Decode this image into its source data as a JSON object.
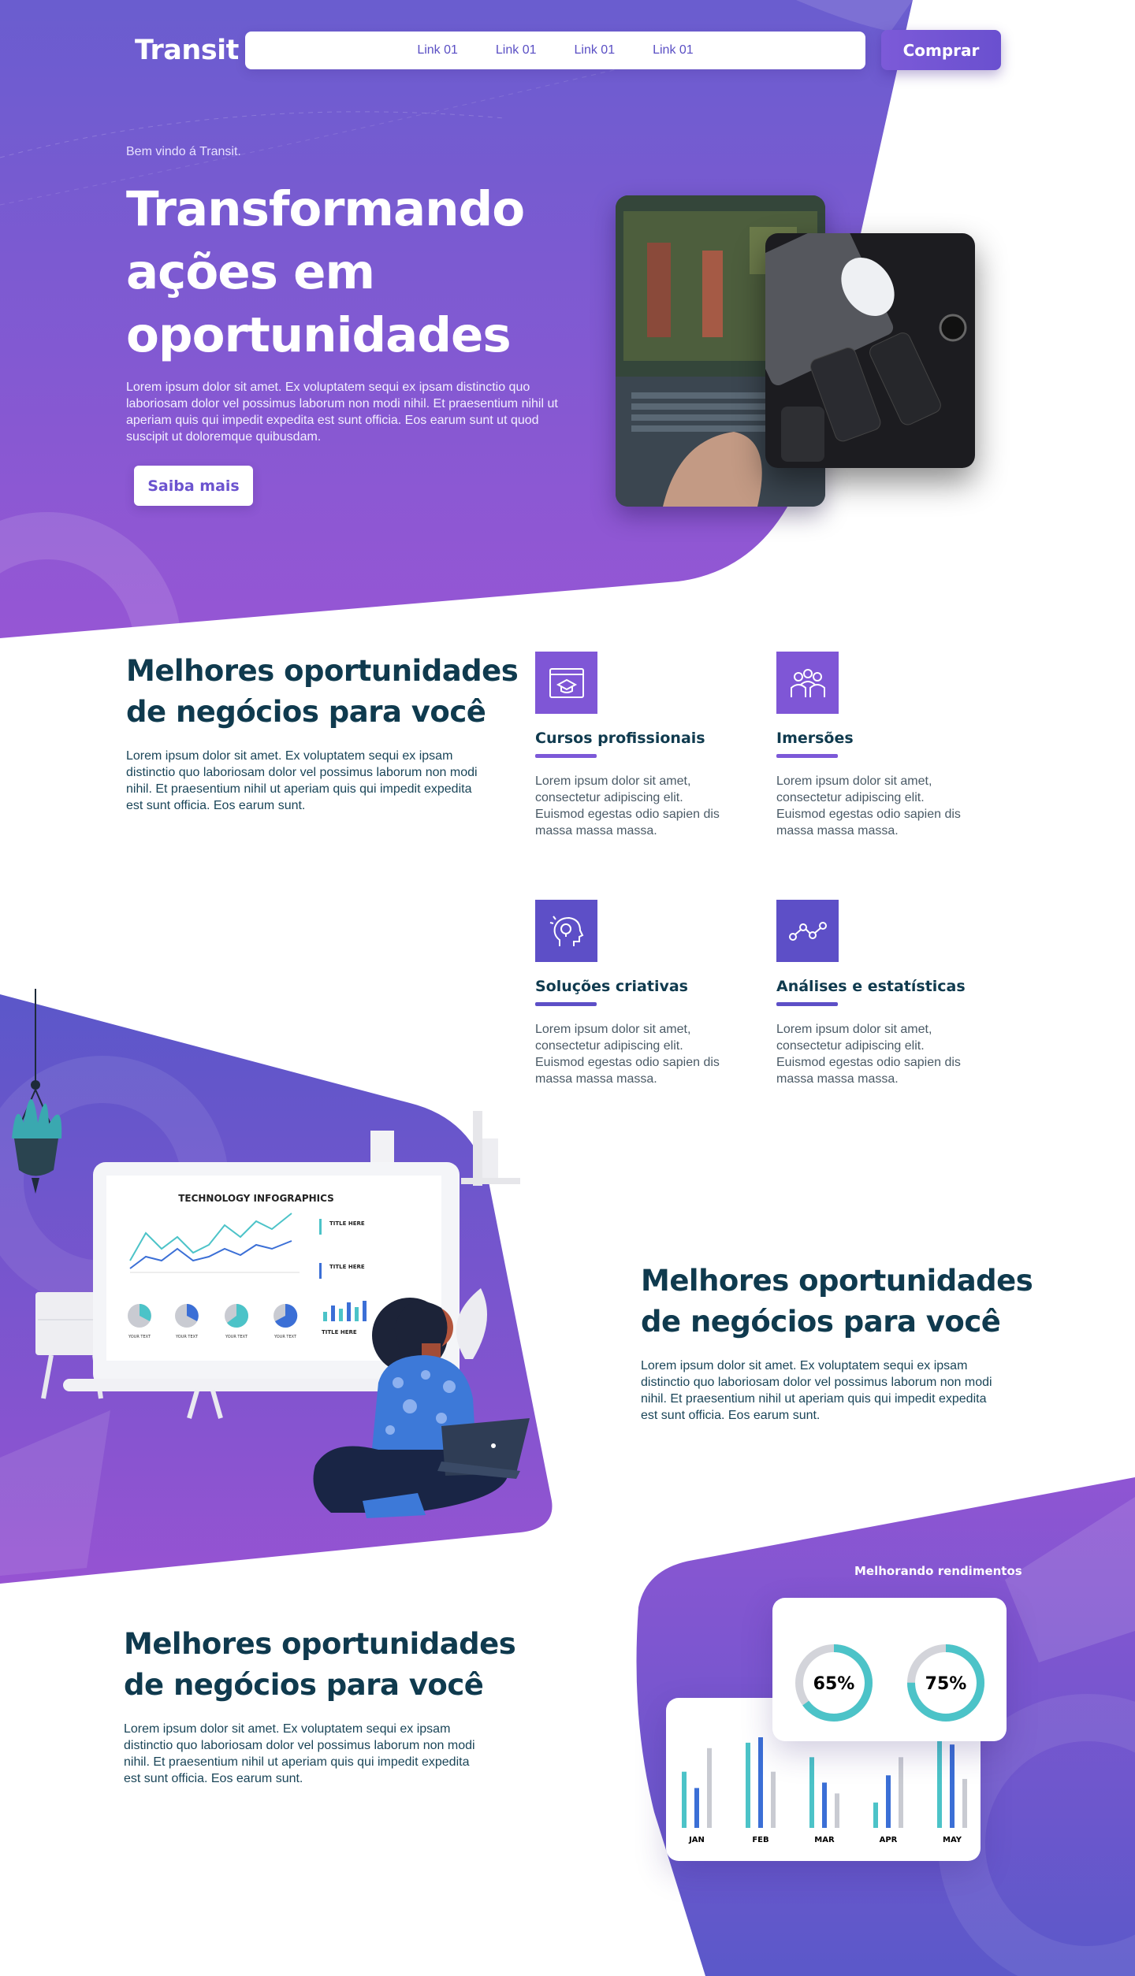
{
  "header": {
    "logo": "Transit",
    "nav_links": [
      "Link 01",
      "Link 01",
      "Link 01",
      "Link 01"
    ],
    "buy_label": "Comprar"
  },
  "hero": {
    "welcome": "Bem vindo á Transit.",
    "title": "Transformando ações em oportunidades",
    "description": "Lorem ipsum dolor sit amet. Ex voluptatem sequi ex ipsam distinctio quo laboriosam dolor vel possimus laborum non modi nihil. Et praesentium nihil ut aperiam quis qui impedit expedita est sunt officia. Eos earum sunt ut quod suscipit ut doloremque quibusdam.",
    "cta_label": "Saiba mais"
  },
  "opportunities": {
    "title": "Melhores oportunidades de negócios para você",
    "description": "Lorem ipsum dolor sit amet. Ex voluptatem sequi ex ipsam distinctio quo laboriosam dolor vel possimus laborum non modi nihil. Et praesentium nihil ut aperiam quis qui impedit expedita est sunt officia. Eos earum sunt.",
    "features": [
      {
        "title": "Cursos profissionais",
        "icon": "graduation-cap-browser-icon",
        "description": "Lorem ipsum dolor sit amet, consectetur adipiscing elit. Euismod egestas odio sapien dis massa massa massa."
      },
      {
        "title": "Imersões",
        "icon": "group-people-icon",
        "description": "Lorem ipsum dolor sit amet, consectetur adipiscing elit. Euismod egestas odio sapien dis massa massa massa."
      },
      {
        "title": "Soluções criativas",
        "icon": "head-lightbulb-icon",
        "description": "Lorem ipsum dolor sit amet, consectetur adipiscing elit. Euismod egestas odio sapien dis massa massa massa."
      },
      {
        "title": "Análises e estatísticas",
        "icon": "line-chart-nodes-icon",
        "description": "Lorem ipsum dolor sit amet, consectetur adipiscing elit. Euismod egestas odio sapien dis massa massa massa."
      }
    ]
  },
  "illustration_section": {
    "title": "Melhores oportunidades de negócios para você",
    "description": "Lorem ipsum dolor sit amet. Ex voluptatem sequi ex ipsam distinctio quo laboriosam dolor vel possimus laborum non modi nihil. Et praesentium nihil ut aperiam quis qui impedit expedita est sunt officia. Eos earum sunt.",
    "screen": {
      "title": "TECHNOLOGY INFOGRAPHICS",
      "side_title_1": "TITLE HERE",
      "side_title_2": "TITLE HERE",
      "bottom_title": "TITLE HERE",
      "pie_labels": [
        "YOUR TEXT",
        "YOUR TEXT",
        "YOUR TEXT",
        "YOUR TEXT"
      ]
    }
  },
  "stats_section": {
    "title": "Melhores oportunidades de negócios para você",
    "description": "Lorem ipsum dolor sit amet. Ex voluptatem sequi ex ipsam distinctio quo laboriosam dolor vel possimus laborum non modi nihil. Et praesentium nihil ut aperiam quis qui impedit expedita est sunt officia. Eos earum sunt.",
    "label": "Melhorando rendimentos",
    "donuts": [
      {
        "value": 65,
        "text": "65%"
      },
      {
        "value": 75,
        "text": "75%"
      }
    ],
    "bars": {
      "months": [
        "JAN",
        "FEB",
        "MAR",
        "APR",
        "MAY"
      ],
      "series": [
        {
          "color": "#4cc3c8",
          "values": [
            62,
            94,
            78,
            28,
            100
          ]
        },
        {
          "color": "#3b6fd6",
          "values": [
            44,
            100,
            50,
            58,
            92
          ]
        },
        {
          "color": "#c9cbd2",
          "values": [
            88,
            62,
            38,
            78,
            54
          ]
        }
      ]
    }
  },
  "colors": {
    "purple_top": "#6a5ccf",
    "purple_bottom": "#8e55d2",
    "heading": "#0f3a4e",
    "accent": "#7c59d8"
  }
}
